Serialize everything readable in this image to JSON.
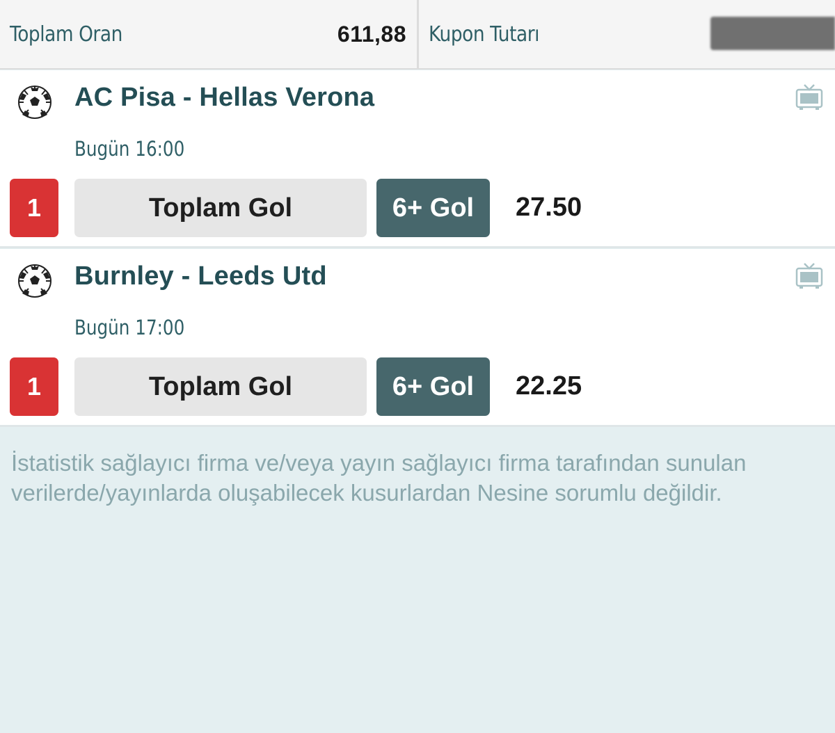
{
  "header": {
    "total_odds_label": "Toplam Oran",
    "total_odds_value": "611,88",
    "stake_label": "Kupon Tutarı"
  },
  "matches": [
    {
      "sport_icon": "soccer-ball-icon",
      "tv_icon": "tv-icon",
      "name": "AC Pisa - Hellas Verona",
      "time": "Bugün 16:00",
      "badge": "1",
      "market": "Toplam Gol",
      "selection": "6+ Gol",
      "odd": "27.50"
    },
    {
      "sport_icon": "soccer-ball-icon",
      "tv_icon": "tv-icon",
      "name": "Burnley - Leeds Utd",
      "time": "Bugün 17:00",
      "badge": "1",
      "market": "Toplam Gol",
      "selection": "6+ Gol",
      "odd": "22.25"
    }
  ],
  "disclaimer": "İstatistik sağlayıcı firma ve/veya yayın sağlayıcı firma tarafından sunulan verilerde/yayınlarda oluşabilecek kusurlardan Nesine sorumlu değildir.",
  "colors": {
    "badge_red": "#d93334",
    "selection_teal": "#47676c",
    "title_teal": "#244e55",
    "page_bg": "#e4eff1"
  }
}
